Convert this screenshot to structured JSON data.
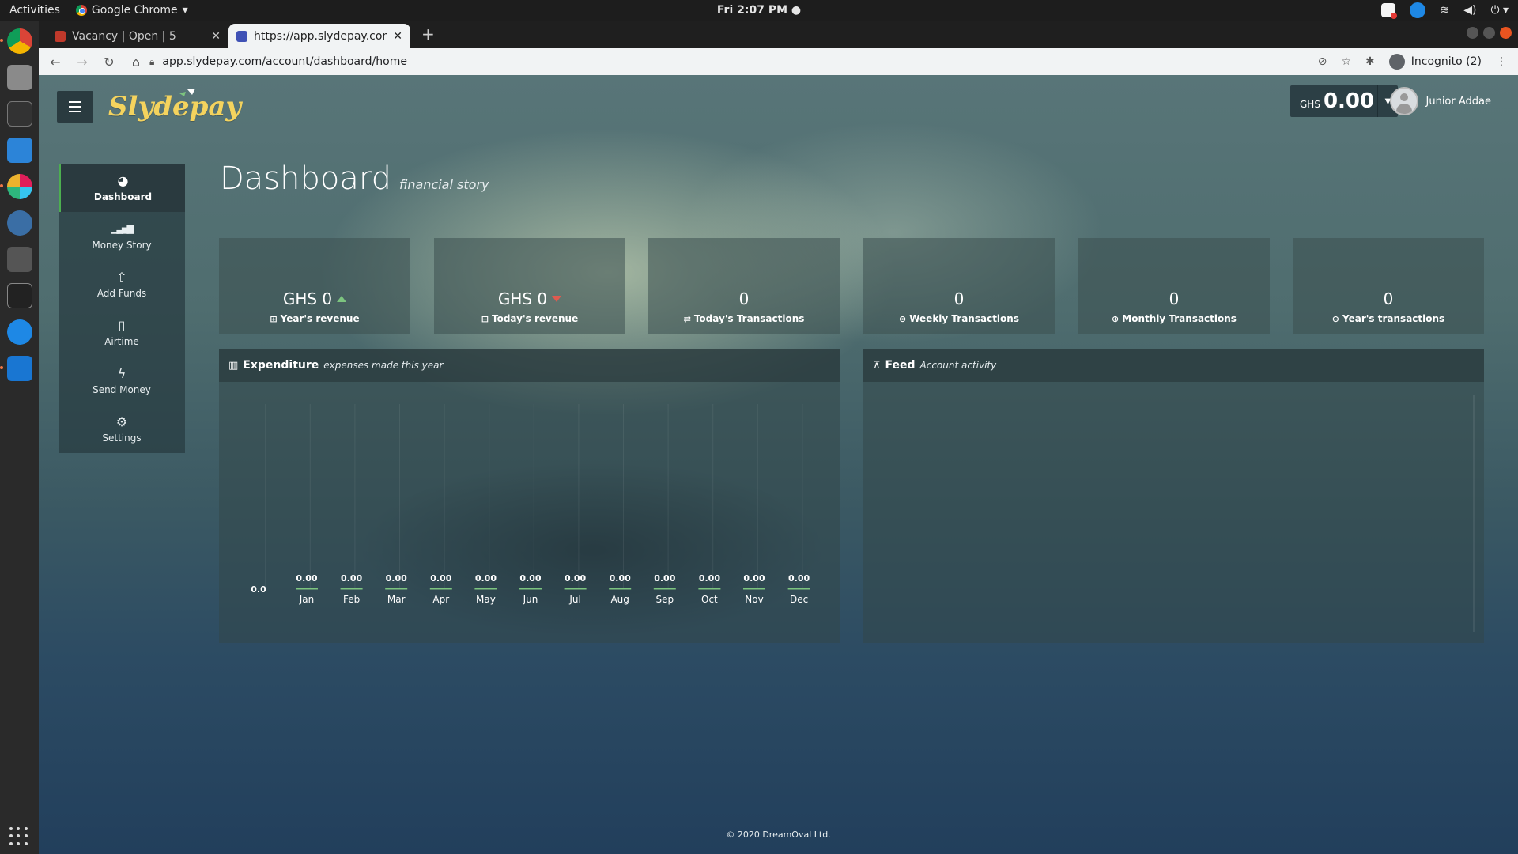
{
  "system": {
    "activities": "Activities",
    "app_menu": "Google Chrome",
    "clock": "Fri  2:07 PM ●"
  },
  "browser": {
    "tabs": [
      {
        "title": "Vacancy | Open | 5",
        "favicon_color": "#c0392b"
      },
      {
        "title": "https://app.slydepay.com",
        "favicon_color": "#3f51b5"
      }
    ],
    "url": "app.slydepay.com/account/dashboard/home",
    "incognito_label": "Incognito (2)"
  },
  "header": {
    "logo": "Slydepay",
    "balance_currency": "GHS",
    "balance_amount": "0.00",
    "user_name": "Junior Addae"
  },
  "sidebar": {
    "items": [
      {
        "label": "Dashboard",
        "icon": "dashboard-icon",
        "glyph": "◕"
      },
      {
        "label": "Money Story",
        "icon": "signal-bars-icon",
        "glyph": "▁▃▅▇"
      },
      {
        "label": "Add Funds",
        "icon": "upload-arrow-icon",
        "glyph": "⇧"
      },
      {
        "label": "Airtime",
        "icon": "phone-icon",
        "glyph": "▯"
      },
      {
        "label": "Send Money",
        "icon": "bolt-icon",
        "glyph": "ϟ"
      },
      {
        "label": "Settings",
        "icon": "gears-icon",
        "glyph": "⚙"
      }
    ]
  },
  "page": {
    "title": "Dashboard",
    "subtitle": "financial story",
    "footer": "© 2020 DreamOval Ltd."
  },
  "stats": [
    {
      "value": "GHS 0",
      "label": "Year's revenue",
      "icon": "plus-square-icon",
      "glyph": "⊞",
      "trend": "up"
    },
    {
      "value": "GHS 0",
      "label": "Today's revenue",
      "icon": "minus-square-icon",
      "glyph": "⊟",
      "trend": "down"
    },
    {
      "value": "0",
      "label": "Today's Transactions",
      "icon": "exchange-icon",
      "glyph": "⇄",
      "trend": ""
    },
    {
      "value": "0",
      "label": "Weekly Transactions",
      "icon": "clock-circle-icon",
      "glyph": "⊙",
      "trend": ""
    },
    {
      "value": "0",
      "label": "Monthly Transactions",
      "icon": "plus-circle-icon",
      "glyph": "⊕",
      "trend": ""
    },
    {
      "value": "0",
      "label": "Year's transactions",
      "icon": "minus-circle-icon",
      "glyph": "⊖",
      "trend": ""
    }
  ],
  "expenditure": {
    "title": "Expenditure",
    "subtitle": "expenses made this year"
  },
  "feed": {
    "title": "Feed",
    "subtitle": "Account activity"
  },
  "chart_data": {
    "type": "bar",
    "categories": [
      "Jan",
      "Feb",
      "Mar",
      "Apr",
      "May",
      "Jun",
      "Jul",
      "Aug",
      "Sep",
      "Oct",
      "Nov",
      "Dec"
    ],
    "values": [
      0.0,
      0.0,
      0.0,
      0.0,
      0.0,
      0.0,
      0.0,
      0.0,
      0.0,
      0.0,
      0.0,
      0.0
    ],
    "value_labels": [
      "0.00",
      "0.00",
      "0.00",
      "0.00",
      "0.00",
      "0.00",
      "0.00",
      "0.00",
      "0.00",
      "0.00",
      "0.00",
      "0.00"
    ],
    "y_tick_labels": [
      "0.0"
    ],
    "grid": true,
    "bar_color": "#7cc47f"
  }
}
